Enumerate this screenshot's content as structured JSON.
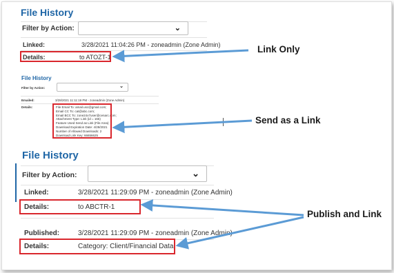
{
  "colors": {
    "title_blue": "#1f66a6",
    "highlight_red": "#d9262c",
    "arrow_blue": "#5b9bd5"
  },
  "panel1": {
    "title": "File History",
    "filter_label": "Filter by Action:",
    "filter_value": "",
    "linked_label": "Linked:",
    "linked_value": "3/28/2021 11:04:26 PM - zoneadmin (Zone Admin)",
    "details_label": "Details:",
    "details_value": "to ATOZT-1"
  },
  "panel2": {
    "title": "File History",
    "filter_label": "Filter by Action:",
    "filter_value": "",
    "emailed_label": "Emailed:",
    "emailed_value": "3/28/2021 11:11:19 PM - zoneadmin (Zone Admin)",
    "details_label": "Details:",
    "details_lines": [
      "File Email To: amail.usc@gmail.com;",
      "Email CC To: cat@abc.com;",
      "Email BCC To: zone24x7user@cenarc.com;",
      "Attachment Type: Link (id = 166)",
      "Feature Used Send as Link (File Area)",
      "Download Expiration Date: 4/28/2021",
      "Number of Allowed Downloads: 2",
      "Download Link Key: 66656625"
    ]
  },
  "panel3": {
    "title": "File History",
    "filter_label": "Filter by Action:",
    "filter_value": "",
    "linked_label": "Linked:",
    "linked_value": "3/28/2021 11:29:09 PM - zoneadmin (Zone Admin)",
    "details1_label": "Details:",
    "details1_value": "to ABCTR-1",
    "published_label": "Published:",
    "published_value": "3/28/2021 11:29:09 PM - zoneadmin (Zone Admin)",
    "details2_label": "Details:",
    "details2_value": "Category: Client/Financial Data"
  },
  "callouts": {
    "link_only": "Link Only",
    "send_as_link": "Send as a Link",
    "publish_and_link": "Publish and Link"
  },
  "icons": {
    "dropdown": "chevron-down-icon",
    "arrow": "arrow-left-icon"
  }
}
